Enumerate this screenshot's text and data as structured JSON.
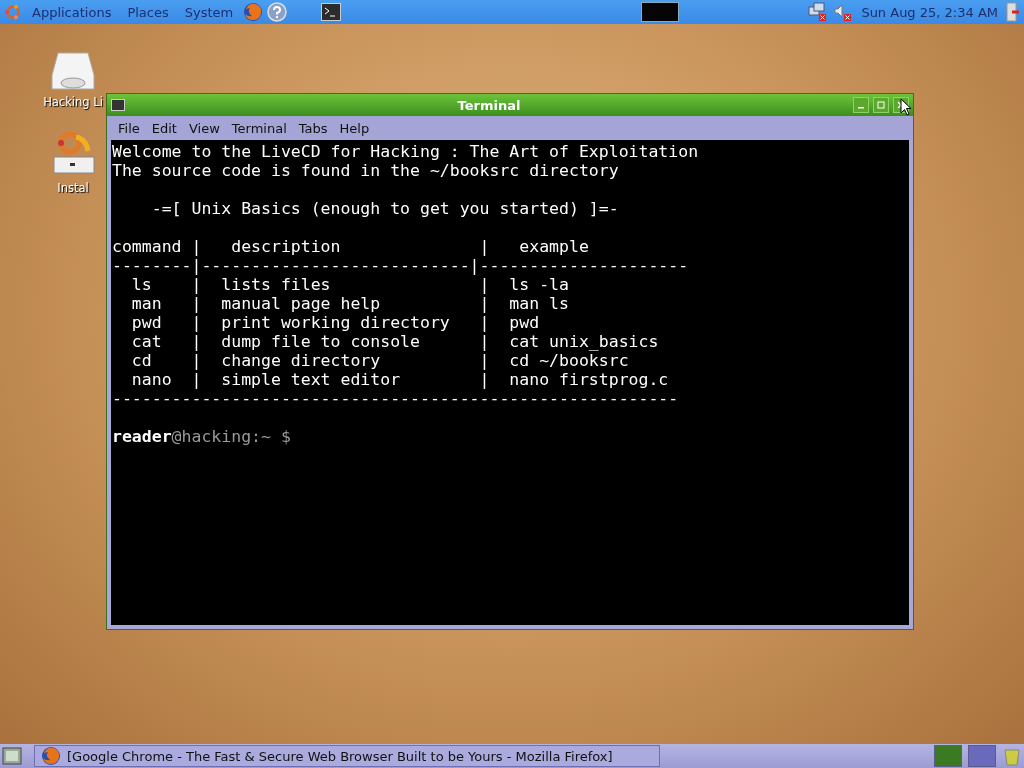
{
  "top_panel": {
    "menus": [
      "Applications",
      "Places",
      "System"
    ],
    "clock": "Sun Aug 25,  2:34 AM"
  },
  "desktop_icons": [
    {
      "label": "Hacking Li",
      "kind": "drive"
    },
    {
      "label": "Instal",
      "kind": "installer"
    }
  ],
  "window": {
    "title": "Terminal",
    "menu": [
      "File",
      "Edit",
      "View",
      "Terminal",
      "Tabs",
      "Help"
    ],
    "blocks": [
      [
        "Welcome to the LiveCD for Hacking : The Art of Exploitation",
        "The source code is found in the ~/booksrc directory"
      ],
      [
        "    -=[ Unix Basics (enough to get you started) ]=-"
      ],
      [
        "command |   description              |   example",
        "--------|---------------------------|---------------------",
        "  ls    |  lists files               |  ls -la",
        "  man   |  manual page help          |  man ls",
        "  pwd   |  print working directory   |  pwd",
        "  cat   |  dump file to console      |  cat unix_basics",
        "  cd    |  change directory          |  cd ~/booksrc",
        "  nano  |  simple text editor        |  nano firstprog.c",
        "---------------------------------------------------------"
      ]
    ],
    "prompt": {
      "user": "reader",
      "host": "@hacking:~ $"
    }
  },
  "bottom_panel": {
    "task": "[Google Chrome - The Fast & Secure Web Browser Built to be Yours - Mozilla Firefox]",
    "workspaces": [
      {
        "selected": true
      },
      {
        "selected": false
      }
    ]
  }
}
